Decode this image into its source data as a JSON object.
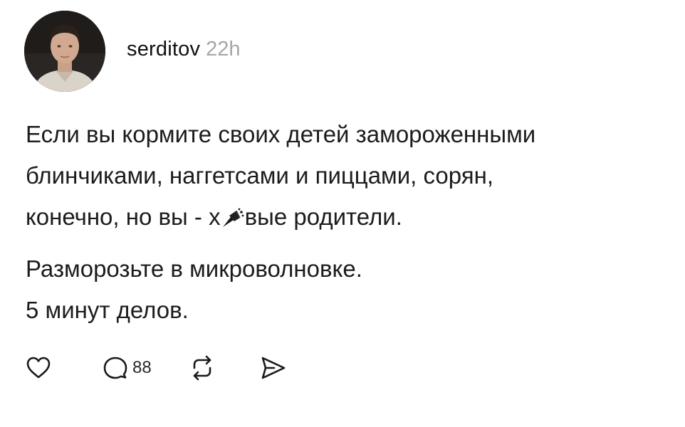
{
  "post": {
    "author": {
      "username": "serditov",
      "time_ago": "22h"
    },
    "text": {
      "line1": "Если вы кормите своих детей замороженными",
      "line2": "блинчиками, наггетсами и пиццами, сорян,",
      "line3_before": "конечно, но вы - х",
      "line3_after": "вые родители.",
      "line4": "Разморозьте в микроволновке.",
      "line5": "5 минут делов."
    },
    "actions": {
      "like_icon": "heart-icon",
      "comment_icon": "comment-icon",
      "comment_count": "88",
      "repost_icon": "repost-icon",
      "share_icon": "send-icon"
    }
  }
}
